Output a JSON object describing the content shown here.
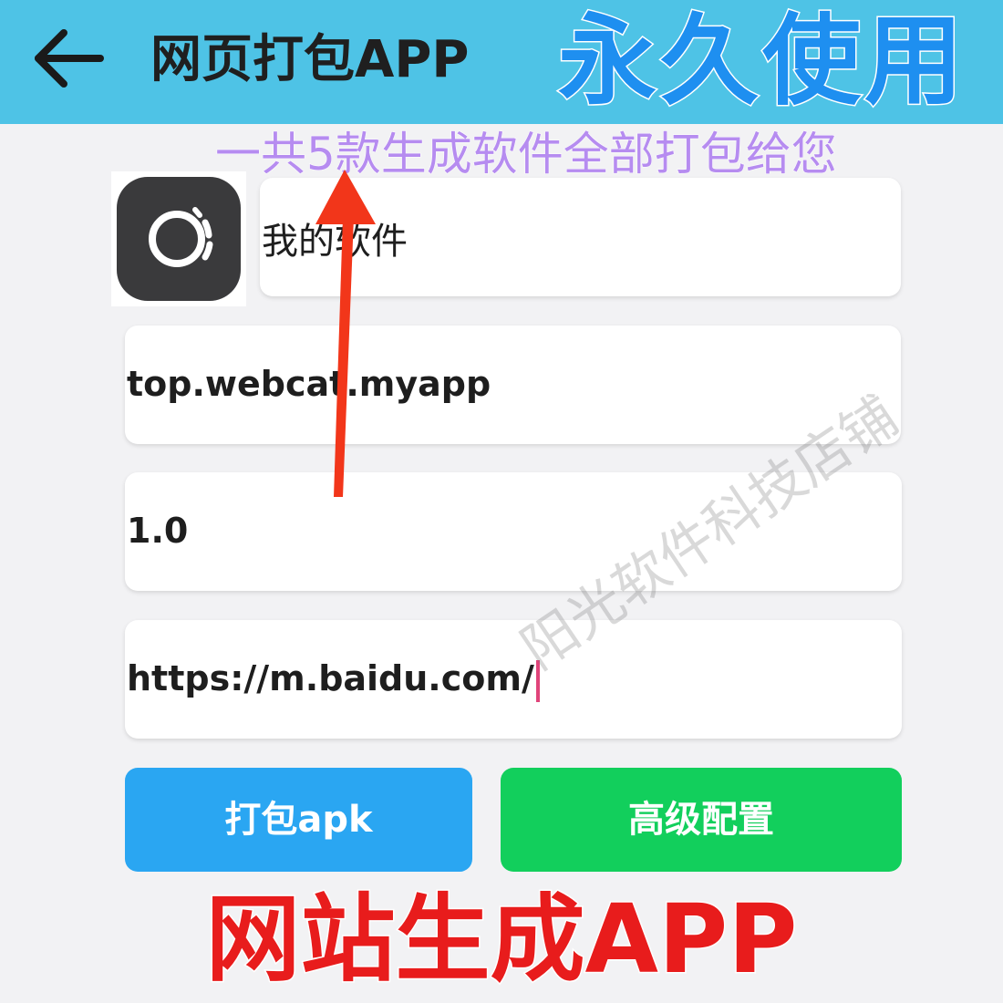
{
  "header": {
    "title": "网页打包APP",
    "back_icon": "arrow-left-icon",
    "background_color": "#4ec3e6"
  },
  "promo": {
    "forever_text": "永久使用",
    "count_text": "一共5款生成软件全部打包给您",
    "banner_text": "网站生成APP"
  },
  "form": {
    "app_icon": "app-logo-icon",
    "app_name": "我的软件",
    "package_name": "top.webcat.myapp",
    "version": "1.0",
    "url": "https://m.baidu.com/"
  },
  "buttons": {
    "pack_label": "打包apk",
    "pack_color": "#2aa6f2",
    "advanced_label": "高级配置",
    "advanced_color": "#12cf5c"
  },
  "watermark": "阳光软件科技店铺",
  "annotation": {
    "arrow_color": "#f2361a"
  }
}
